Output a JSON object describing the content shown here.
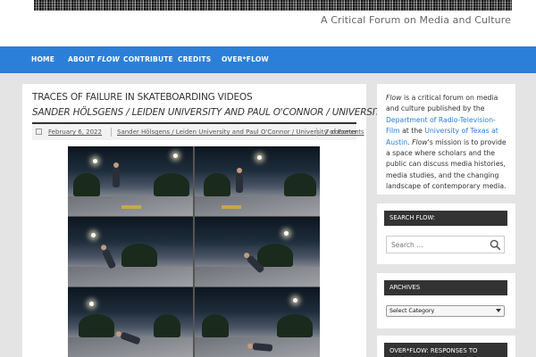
{
  "header": {
    "tagline": "A Critical Forum on Media and Culture"
  },
  "nav": {
    "items": [
      {
        "label": "HOME"
      },
      {
        "label": "ABOUT",
        "suffix": "FLOW"
      },
      {
        "label": "CONTRIBUTE"
      },
      {
        "label": "CREDITS"
      },
      {
        "label": "OVER*FLOW"
      }
    ]
  },
  "post": {
    "title": "TRACES OF FAILURE IN SKATEBOARDING VIDEOS",
    "subtitle": "SANDER HÖLSGENS / LEIDEN UNIVERSITY AND PAUL O'CONNOR / UNIVERSITY OF EXETER",
    "date": "February 6, 2022",
    "authors": "Sander Hölsgens / Leiden University and Paul O'Connor / University of Exeter",
    "comments": "7 comments"
  },
  "sidebar": {
    "about": {
      "flow1": "Flow",
      "text1": " is a critical forum on media and culture published by the ",
      "dept_link": "Department of Radio-Television-Film",
      "text2": " at the ",
      "univ_link": "University of Texas at Austin",
      "text3": ". ",
      "flow2": "Flow",
      "text4": "'s mission is to provide a space where scholars and the public can discuss media histories, media studies, and the changing landscape of contemporary media."
    },
    "search": {
      "title": "SEARCH FLOW:",
      "placeholder": "Search …"
    },
    "archives": {
      "title": "ARCHIVES",
      "selected": "Select Category"
    },
    "overflow": {
      "title": "OVER*FLOW: RESPONSES TO BREAKING TV & MEDIA NEWS"
    }
  }
}
